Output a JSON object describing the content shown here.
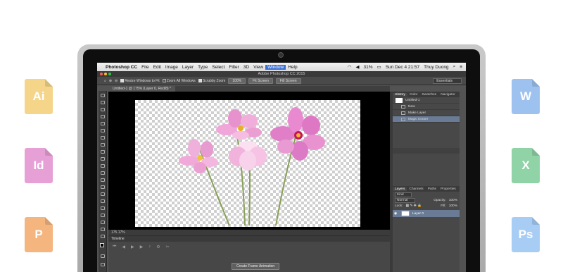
{
  "file_icons": [
    {
      "label": "Ai",
      "color": "#f4d58a",
      "side": "left"
    },
    {
      "label": "Id",
      "color": "#e6a0d6",
      "side": "left"
    },
    {
      "label": "P",
      "color": "#f5b57f",
      "side": "left"
    },
    {
      "label": "W",
      "color": "#9ec2f0",
      "side": "right"
    },
    {
      "label": "X",
      "color": "#8fd3a6",
      "side": "right"
    },
    {
      "label": "Ps",
      "color": "#a8cdf5",
      "side": "right"
    }
  ],
  "menubar": {
    "app": "Photoshop CC",
    "items": [
      "File",
      "Edit",
      "Image",
      "Layer",
      "Type",
      "Select",
      "Filter",
      "3D",
      "View",
      "Window",
      "Help"
    ],
    "active_item": "Window",
    "battery": "31%",
    "datetime": "Sun Dec 4  21:57",
    "user": "Thuy Duong"
  },
  "window": {
    "title": "Adobe Photoshop CC 2015"
  },
  "options": {
    "resize_windows": "Resize Windows to Fit",
    "zoom_all": "Zoom All Windows",
    "scrubby_zoom": "Scrubby Zoom",
    "zoom_100": "100%",
    "fit_screen": "Fit Screen",
    "fill_screen": "Fill Screen",
    "workspace": "Essentials"
  },
  "document": {
    "tab": "Untitled-1 @ 175% (Layer 0, Red/8) *",
    "zoom_status": "175.17%"
  },
  "timeline": {
    "title": "Timeline",
    "create_button": "Create Frame Animation"
  },
  "history_panel": {
    "tabs": [
      "History",
      "Color",
      "Swatches",
      "Navigator"
    ],
    "snapshot": "Untitled-1",
    "steps": [
      "New",
      "Make Layer",
      "Magic Eraser"
    ],
    "selected_step": "Magic Eraser"
  },
  "layers_panel": {
    "tabs": [
      "Layers",
      "Channels",
      "Paths",
      "Properties"
    ],
    "filter_kind": "Kind",
    "blend_mode": "Normal",
    "opacity_label": "Opacity:",
    "opacity_value": "100%",
    "lock_label": "Lock:",
    "fill_label": "Fill:",
    "fill_value": "100%",
    "layer_name": "Layer 0"
  }
}
